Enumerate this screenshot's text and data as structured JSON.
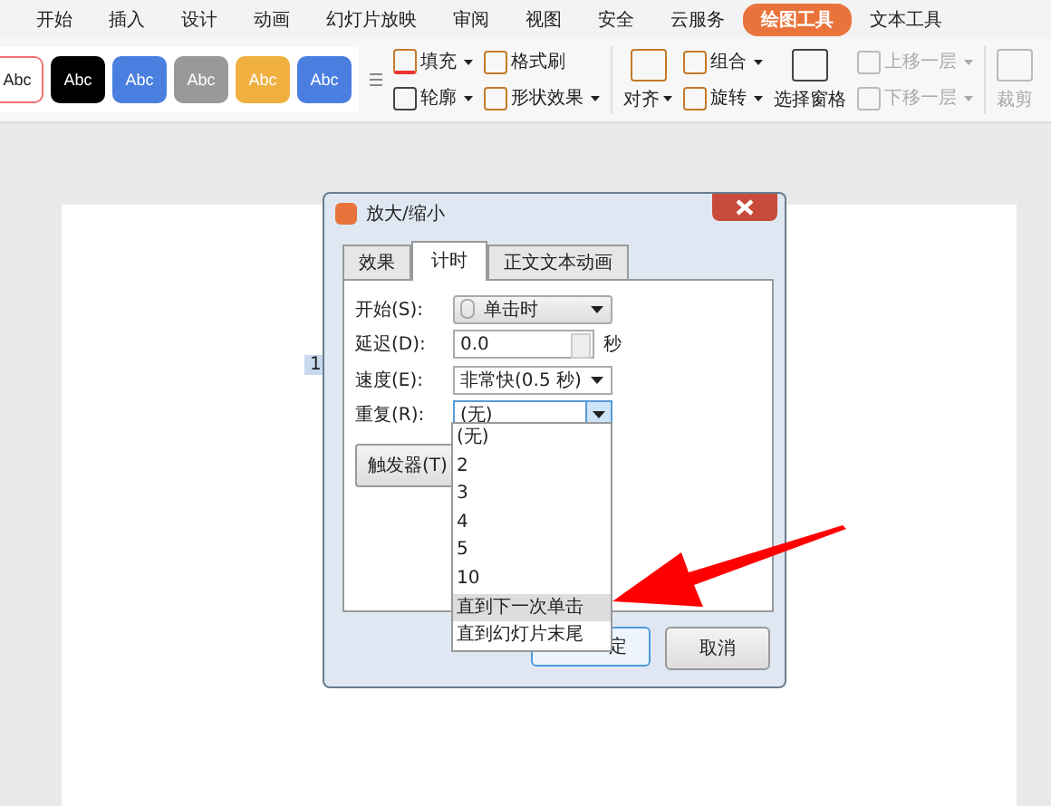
{
  "menu_tabs": [
    {
      "label": "开始",
      "selected": false
    },
    {
      "label": "插入",
      "selected": false
    },
    {
      "label": "设计",
      "selected": false
    },
    {
      "label": "动画",
      "selected": false
    },
    {
      "label": "幻灯片放映",
      "selected": false
    },
    {
      "label": "审阅",
      "selected": false
    },
    {
      "label": "视图",
      "selected": false
    },
    {
      "label": "安全",
      "selected": false
    },
    {
      "label": "云服务",
      "selected": false
    },
    {
      "label": "绘图工具",
      "selected": true
    },
    {
      "label": "文本工具",
      "selected": false
    }
  ],
  "shape_styles": [
    {
      "label": "Abc",
      "color": "#ffffff"
    },
    {
      "label": "Abc",
      "color": "#000000"
    },
    {
      "label": "Abc",
      "color": "#4a7fe0"
    },
    {
      "label": "Abc",
      "color": "#999999"
    },
    {
      "label": "Abc",
      "color": "#f0b040"
    },
    {
      "label": "Abc",
      "color": "#4a7fe0"
    }
  ],
  "ribbon_tools": [
    {
      "label": "填充",
      "kind": "fill",
      "disabled": false,
      "dropdown": true
    },
    {
      "label": "轮廓",
      "kind": "outline",
      "disabled": false,
      "dropdown": true
    },
    {
      "label": "格式刷",
      "kind": "brush",
      "disabled": false,
      "dropdown": false
    },
    {
      "label": "形状效果",
      "kind": "effect",
      "disabled": false,
      "dropdown": true
    },
    {
      "label": "对齐",
      "kind": "align",
      "disabled": false,
      "dropdown": true
    },
    {
      "label": "组合",
      "kind": "group",
      "disabled": false,
      "dropdown": true
    },
    {
      "label": "旋转",
      "kind": "rotate",
      "disabled": false,
      "dropdown": true
    },
    {
      "label": "选择窗格",
      "kind": "pane",
      "disabled": false,
      "dropdown": false
    },
    {
      "label": "上移一层",
      "kind": "up",
      "disabled": true,
      "dropdown": true
    },
    {
      "label": "下移一层",
      "kind": "down",
      "disabled": true,
      "dropdown": true
    },
    {
      "label": "裁剪",
      "kind": "crop",
      "disabled": true,
      "dropdown": false
    }
  ],
  "slide": {
    "marker": "1"
  },
  "dialog": {
    "title": "放大/缩小",
    "tabs": [
      {
        "label": "效果",
        "selected": false
      },
      {
        "label": "计时",
        "selected": true
      },
      {
        "label": "正文文本动画",
        "selected": false
      }
    ],
    "fields": [
      {
        "label": "开始(S):",
        "kind": "select",
        "value": "单击时",
        "icon": true
      },
      {
        "label": "延迟(D):",
        "kind": "spin",
        "value": "0.0",
        "suffix": "秒"
      },
      {
        "label": "速度(E):",
        "kind": "select",
        "value": "非常快(0.5 秒)"
      },
      {
        "label": "重复(R):",
        "kind": "open",
        "value": "(无)"
      }
    ],
    "trigger": "触发器(T)",
    "ok": "定",
    "cancel": "取消",
    "options": [
      {
        "label": "(无)",
        "selected": false
      },
      {
        "label": "2",
        "selected": false
      },
      {
        "label": "3",
        "selected": false
      },
      {
        "label": "4",
        "selected": false
      },
      {
        "label": "5",
        "selected": false
      },
      {
        "label": "10",
        "selected": false
      },
      {
        "label": "直到下一次单击",
        "selected": true
      },
      {
        "label": "直到幻灯片末尾",
        "selected": false
      }
    ]
  }
}
